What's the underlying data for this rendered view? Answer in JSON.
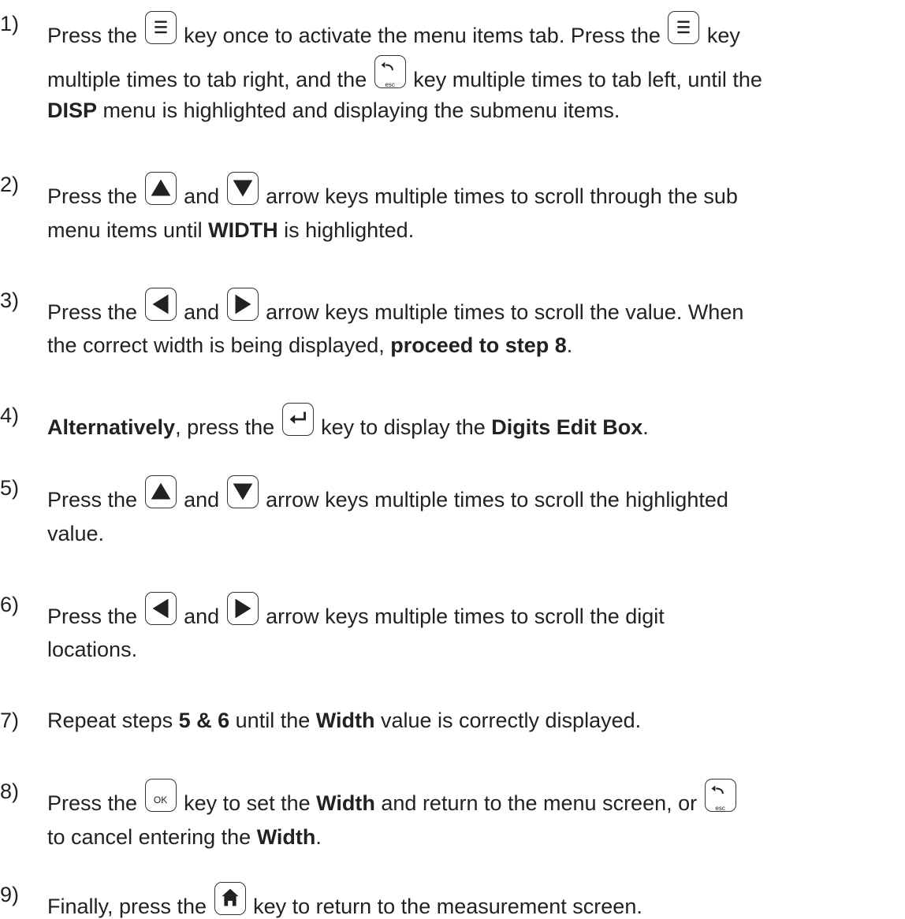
{
  "steps": [
    {
      "number": "1)",
      "lines": [
        [
          "Press the ",
          {
            "key": "menu"
          },
          " key once to activate the menu items tab.  Press the ",
          {
            "key": "menu"
          },
          " key"
        ],
        [
          "multiple times to tab right, and the ",
          {
            "key": "esc"
          },
          " key multiple times to tab left, until the"
        ],
        [
          {
            "b": "DISP"
          },
          " menu is highlighted and displaying the submenu items."
        ]
      ]
    },
    {
      "number": "2)",
      "lines": [
        [
          "Press the ",
          {
            "key": "up"
          },
          " and ",
          {
            "key": "down"
          },
          " arrow keys multiple times to scroll through the sub"
        ],
        [
          "menu items until ",
          {
            "b": "WIDTH"
          },
          " is highlighted."
        ]
      ]
    },
    {
      "number": "3)",
      "lines": [
        [
          "Press the ",
          {
            "key": "left"
          },
          " and ",
          {
            "key": "right"
          },
          "  arrow keys multiple times to scroll the value.  When"
        ],
        [
          "the correct width is being displayed, ",
          {
            "b": "proceed to step 8"
          },
          "."
        ]
      ]
    },
    {
      "number": "4)",
      "lines": [
        [
          {
            "b": "Alternatively"
          },
          ", press the ",
          {
            "key": "enter"
          },
          " key to display the ",
          {
            "b": "Digits Edit Box"
          },
          "."
        ]
      ]
    },
    {
      "number": "5)",
      "lines": [
        [
          "Press the ",
          {
            "key": "up"
          },
          " and ",
          {
            "key": "down"
          },
          " arrow keys multiple times to scroll the highlighted"
        ],
        [
          "value."
        ]
      ]
    },
    {
      "number": "6)",
      "lines": [
        [
          "Press the ",
          {
            "key": "left"
          },
          " and ",
          {
            "key": "right"
          },
          "  arrow keys multiple times to scroll the digit"
        ],
        [
          "locations."
        ]
      ]
    },
    {
      "number": "7)",
      "lines": [
        [
          "Repeat steps ",
          {
            "b": "5 & 6"
          },
          " until the ",
          {
            "b": "Width"
          },
          " value is correctly displayed."
        ]
      ]
    },
    {
      "number": "8)",
      "lines": [
        [
          "Press the ",
          {
            "key": "ok"
          },
          " key to set the ",
          {
            "b": "Width"
          },
          " and return to the menu screen, or ",
          {
            "key": "esc"
          }
        ],
        [
          "to cancel entering the ",
          {
            "b": "Width"
          },
          "."
        ]
      ]
    },
    {
      "number": "9)",
      "lines": [
        [
          "Finally, press the ",
          {
            "key": "home"
          },
          " key to return to the measurement screen."
        ]
      ]
    }
  ],
  "key_labels": {
    "ok": "OK",
    "esc": "esc"
  },
  "colors": {
    "text": "#222222",
    "key_border": "#333333",
    "key_symbol": "#222222"
  }
}
